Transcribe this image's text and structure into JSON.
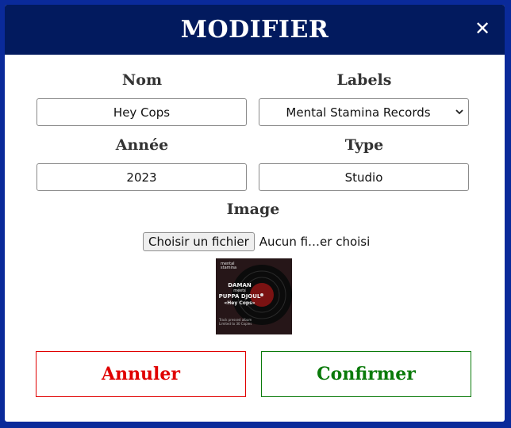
{
  "modal": {
    "title": "MODIFIER",
    "close_icon": "close-icon"
  },
  "form": {
    "nom_label": "Nom",
    "nom_value": "Hey Cops",
    "labels_label": "Labels",
    "labels_value": "Mental Stamina Records",
    "annee_label": "Année",
    "annee_value": "2023",
    "type_label": "Type",
    "type_value": "Studio",
    "image_label": "Image",
    "file_button": "Choisir un fichier",
    "file_status": "Aucun fi…er choisi"
  },
  "cover": {
    "logo_line1": "mental",
    "logo_line2": "stamina",
    "artist1": "DAMAN",
    "meets": "meets",
    "artist2": "PUPPA DJOUL",
    "song": "«Hey Cops»",
    "note1": "Track pressed album",
    "note2": "Limited to 30 Copies"
  },
  "actions": {
    "cancel_label": "Annuler",
    "confirm_label": "Confirmer"
  },
  "colors": {
    "header_bg": "#021a5e",
    "page_bg": "#0a2a9a",
    "cancel": "#e00000",
    "confirm": "#0a7a0a"
  }
}
